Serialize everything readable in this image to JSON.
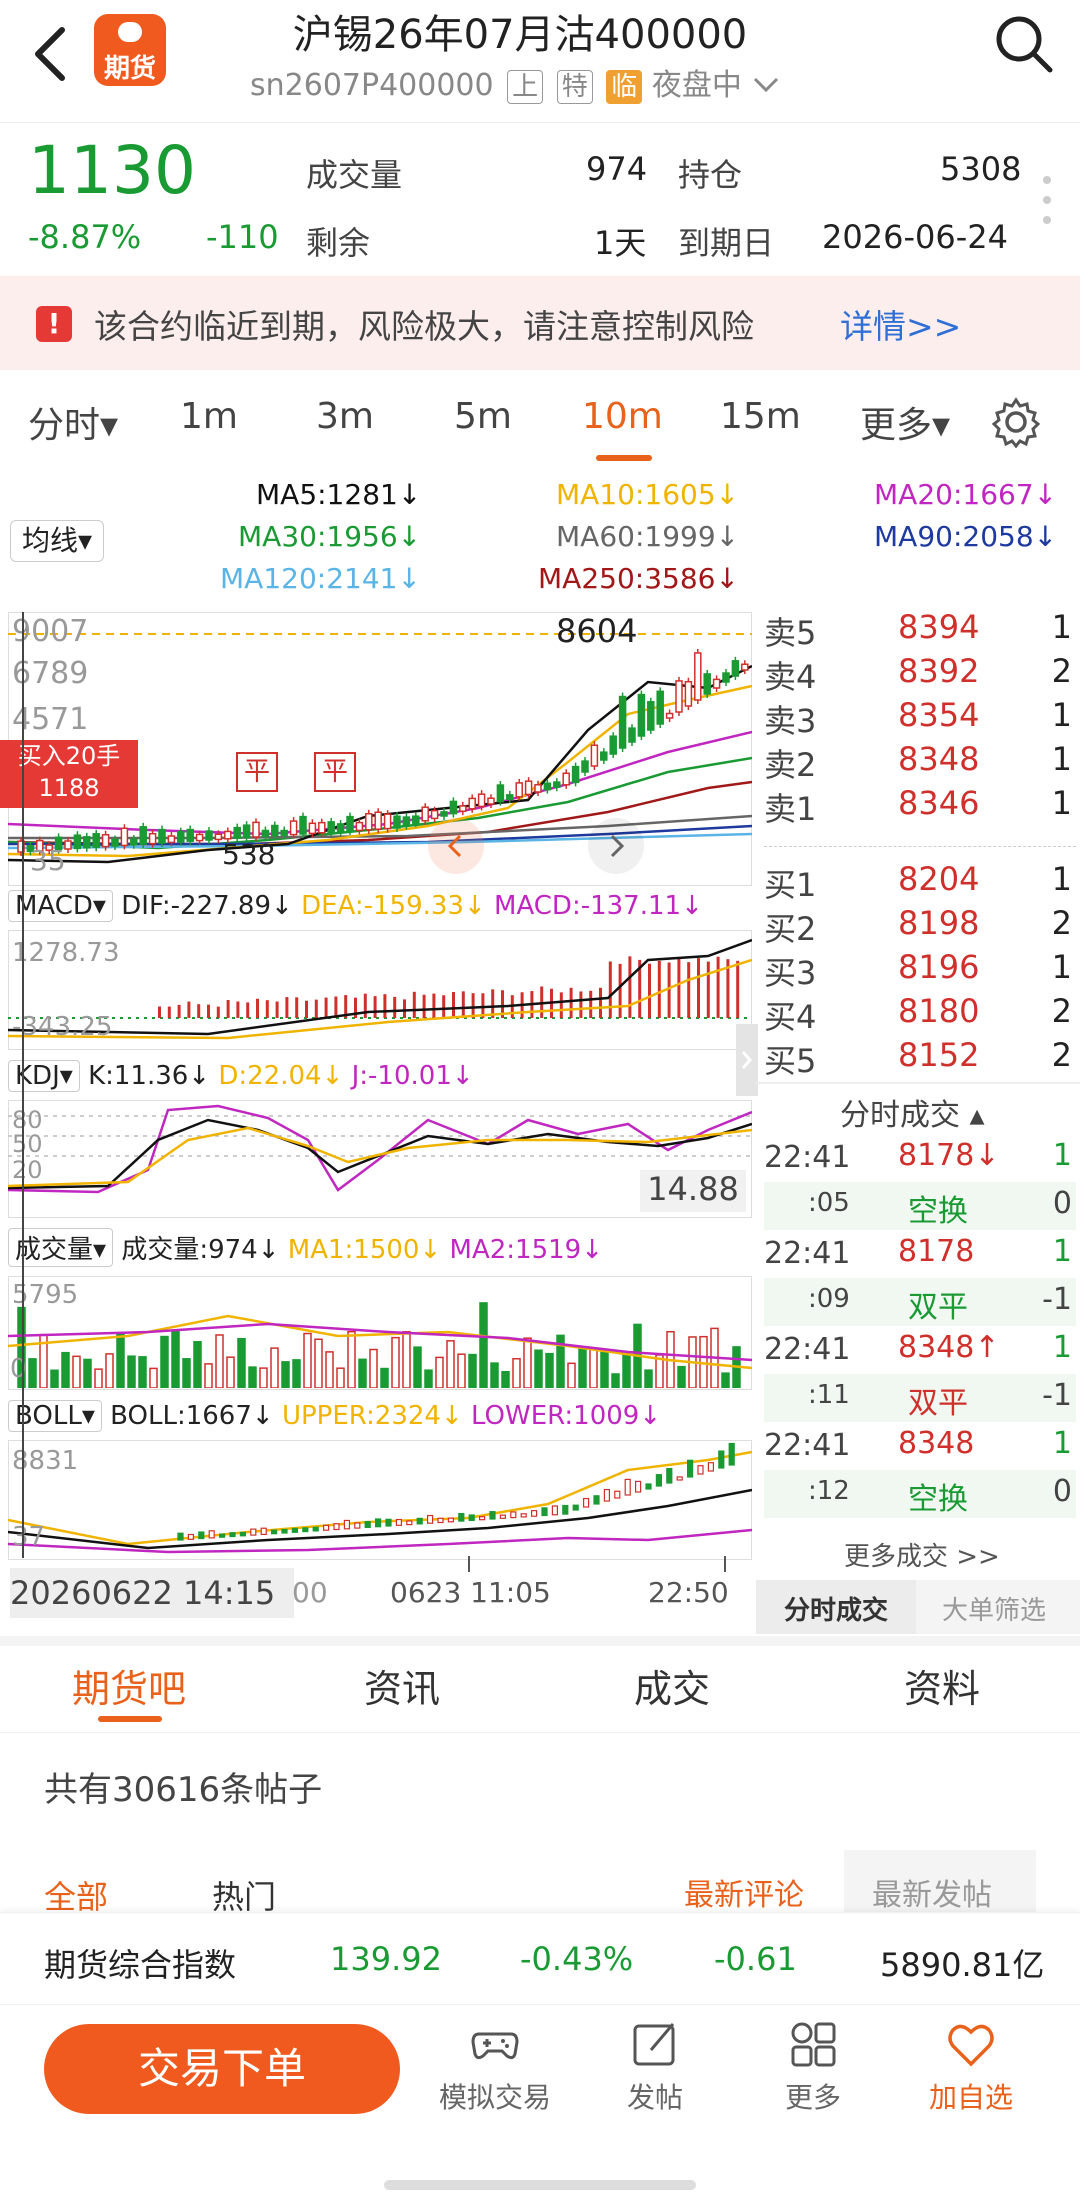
{
  "header": {
    "title": "沪锡26年07月沽400000",
    "code": "sn2607P400000",
    "tags": [
      "上",
      "特",
      "临"
    ],
    "session": "夜盘中",
    "logo_text": "期货"
  },
  "quote": {
    "price": "1130",
    "change_pct": "-8.87%",
    "change": "-110",
    "volume_label": "成交量",
    "volume": "974",
    "oi_label": "持仓",
    "oi": "5308",
    "remain_label": "剩余",
    "remain": "1天",
    "expiry_label": "到期日",
    "expiry": "2026-06-24"
  },
  "warning": {
    "icon": "!",
    "text": "该合约临近到期，风险极大，请注意控制风险",
    "link": "详情>>"
  },
  "periods": [
    {
      "label": "分时▾",
      "active": false
    },
    {
      "label": "1m",
      "active": false
    },
    {
      "label": "3m",
      "active": false
    },
    {
      "label": "5m",
      "active": false
    },
    {
      "label": "10m",
      "active": true
    },
    {
      "label": "15m",
      "active": false
    },
    {
      "label": "更多▾",
      "active": false
    }
  ],
  "ma_legend": {
    "selector": "均线▾",
    "ma5": "MA5:1281↓",
    "ma10": "MA10:1605↓",
    "ma20": "MA20:1667↓",
    "ma30": "MA30:1956↓",
    "ma60": "MA60:1999↓",
    "ma90": "MA90:2058↓",
    "ma120": "MA120:2141↓",
    "ma250": "MA250:3586↓"
  },
  "main_chart": {
    "y_labels": [
      "9007",
      "6789",
      "4571",
      "35"
    ],
    "high_label": "8604",
    "low_label": "538",
    "buy_badge_line1": "买入20手",
    "buy_badge_line2": "1188",
    "ping": "平",
    "ping2": "平",
    "colors": {
      "up": "#d0302b",
      "down": "#1a9a33",
      "ma5": "#111111",
      "ma10": "#f0b400",
      "ma20": "#c026c0",
      "ma30": "#1a9a33",
      "ma60": "#666666",
      "ma90": "#1e3a9e",
      "ma120": "#5ab4e6",
      "ma250": "#a01818"
    }
  },
  "macd": {
    "selector": "MACD▾",
    "dif": "DIF:-227.89↓",
    "dea": "DEA:-159.33↓",
    "macd": "MACD:-137.11↓",
    "y_top": "1278.73",
    "y_mid": "-343.25"
  },
  "kdj": {
    "selector": "KDJ▾",
    "k": "K:11.36↓",
    "d": "D:22.04↓",
    "j": "J:-10.01↓",
    "y80": "80",
    "y50": "50",
    "y20": "20",
    "readout": "14.88"
  },
  "vol": {
    "selector": "成交量▾",
    "v": "成交量:974↓",
    "ma1": "MA1:1500↓",
    "ma2": "MA2:1519↓",
    "y_top": "5795",
    "y_bottom": "0"
  },
  "boll": {
    "selector": "BOLL▾",
    "boll": "BOLL:1667↓",
    "upper": "UPPER:2324↓",
    "lower": "LOWER:1009↓",
    "y_top": "8831",
    "y_bottom": "37"
  },
  "x_axis": {
    "left": "20260622 14:15",
    "left_tail": "00",
    "mid": "0623 11:05",
    "right": "22:50"
  },
  "order_book": {
    "asks": [
      {
        "label": "卖5",
        "price": "8394",
        "vol": "1"
      },
      {
        "label": "卖4",
        "price": "8392",
        "vol": "2"
      },
      {
        "label": "卖3",
        "price": "8354",
        "vol": "1"
      },
      {
        "label": "卖2",
        "price": "8348",
        "vol": "1"
      },
      {
        "label": "卖1",
        "price": "8346",
        "vol": "1"
      }
    ],
    "bids": [
      {
        "label": "买1",
        "price": "8204",
        "vol": "1"
      },
      {
        "label": "买2",
        "price": "8198",
        "vol": "2"
      },
      {
        "label": "买3",
        "price": "8196",
        "vol": "1"
      },
      {
        "label": "买4",
        "price": "8180",
        "vol": "2"
      },
      {
        "label": "买5",
        "price": "8152",
        "vol": "2"
      }
    ]
  },
  "ticks": {
    "title": "分时成交 ▴",
    "rows": [
      {
        "time": "22:41",
        "value": "8178↓",
        "qty": "1",
        "kind": "price-down"
      },
      {
        "time": ":05",
        "value": "空换",
        "qty": "0",
        "kind": "tag-green"
      },
      {
        "time": "22:41",
        "value": "8178",
        "qty": "1",
        "kind": "price"
      },
      {
        "time": ":09",
        "value": "双平",
        "qty": "-1",
        "kind": "tag-green"
      },
      {
        "time": "22:41",
        "value": "8348↑",
        "qty": "1",
        "kind": "price-up"
      },
      {
        "time": ":11",
        "value": "双平",
        "qty": "-1",
        "kind": "tag-red"
      },
      {
        "time": "22:41",
        "value": "8348",
        "qty": "1",
        "kind": "price"
      },
      {
        "time": ":12",
        "value": "空换",
        "qty": "0",
        "kind": "tag-green"
      }
    ],
    "more": "更多成交 >>",
    "tab1": "分时成交",
    "tab2": "大单筛选"
  },
  "bottom_tabs": [
    {
      "label": "期货吧",
      "active": true
    },
    {
      "label": "资讯",
      "active": false
    },
    {
      "label": "成交",
      "active": false
    },
    {
      "label": "资料",
      "active": false
    }
  ],
  "forum": {
    "count_text": "共有30616条帖子",
    "filter_all": "全部",
    "filter_hot": "热门",
    "sort_comment": "最新评论",
    "sort_post": "最新发帖"
  },
  "index_bar": {
    "name": "期货综合指数",
    "value": "139.92",
    "pct": "-0.43%",
    "chg": "-0.61",
    "turnover": "5890.81亿"
  },
  "bottom_nav": {
    "trade": "交易下单",
    "items": [
      {
        "label": "模拟交易",
        "icon": "gamepad-icon"
      },
      {
        "label": "发帖",
        "icon": "edit-icon"
      },
      {
        "label": "更多",
        "icon": "grid-icon"
      },
      {
        "label": "加自选",
        "icon": "heart-icon"
      }
    ]
  }
}
